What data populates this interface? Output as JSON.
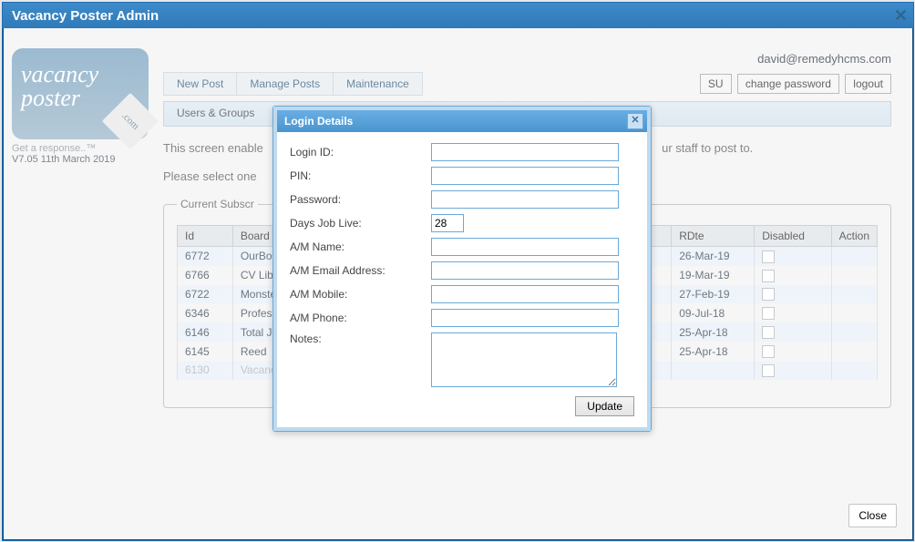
{
  "window": {
    "title": "Vacancy Poster Admin"
  },
  "brand": {
    "line1": "vacancy",
    "line2": "poster",
    "badge": ".com",
    "tag": "Get a response..™",
    "version": "V7.05 11th March 2019"
  },
  "header": {
    "user_email": "david@remedyhcms.com",
    "su": "SU",
    "change_pw": "change password",
    "logout": "logout"
  },
  "menu": {
    "new_post": "New Post",
    "manage_posts": "Manage Posts",
    "maintenance": "Maintenance"
  },
  "submenu": {
    "users_groups": "Users & Groups"
  },
  "content": {
    "line1": "This screen enable",
    "line1_tail": "ur staff to post to.",
    "line2": "Please select one",
    "legend": "Current Subscr"
  },
  "table": {
    "cols": {
      "id": "Id",
      "board": "Board Na",
      "rdte": "RDte",
      "disabled": "Disabled",
      "action": "Action"
    },
    "rows": [
      {
        "id": "6772",
        "board": "OurBob.c",
        "rdte": "26-Mar-19",
        "disabled": false,
        "dim": false
      },
      {
        "id": "6766",
        "board": "CV Librar",
        "rdte": "19-Mar-19",
        "disabled": false,
        "dim": false
      },
      {
        "id": "6722",
        "board": "Monster ",
        "rdte": "27-Feb-19",
        "disabled": false,
        "dim": false
      },
      {
        "id": "6346",
        "board": "Professio",
        "rdte": "09-Jul-18",
        "disabled": false,
        "dim": false
      },
      {
        "id": "6146",
        "board": "Total Job",
        "rdte": "25-Apr-18",
        "disabled": false,
        "dim": false
      },
      {
        "id": "6145",
        "board": "Reed",
        "rdte": "25-Apr-18",
        "disabled": false,
        "dim": false
      },
      {
        "id": "6130",
        "board": "Vacancy",
        "rdte": "",
        "disabled": false,
        "dim": true
      }
    ]
  },
  "dialog": {
    "title": "Login Details",
    "labels": {
      "login_id": "Login ID:",
      "pin": "PIN:",
      "password": "Password:",
      "days": "Days Job Live:",
      "am_name": "A/M Name:",
      "am_email": "A/M Email Address:",
      "am_mobile": "A/M Mobile:",
      "am_phone": "A/M Phone:",
      "notes": "Notes:"
    },
    "values": {
      "login_id": "",
      "pin": "",
      "password": "",
      "days": "28",
      "am_name": "",
      "am_email": "",
      "am_mobile": "",
      "am_phone": "",
      "notes": ""
    },
    "update": "Update"
  },
  "footer": {
    "close": "Close"
  }
}
